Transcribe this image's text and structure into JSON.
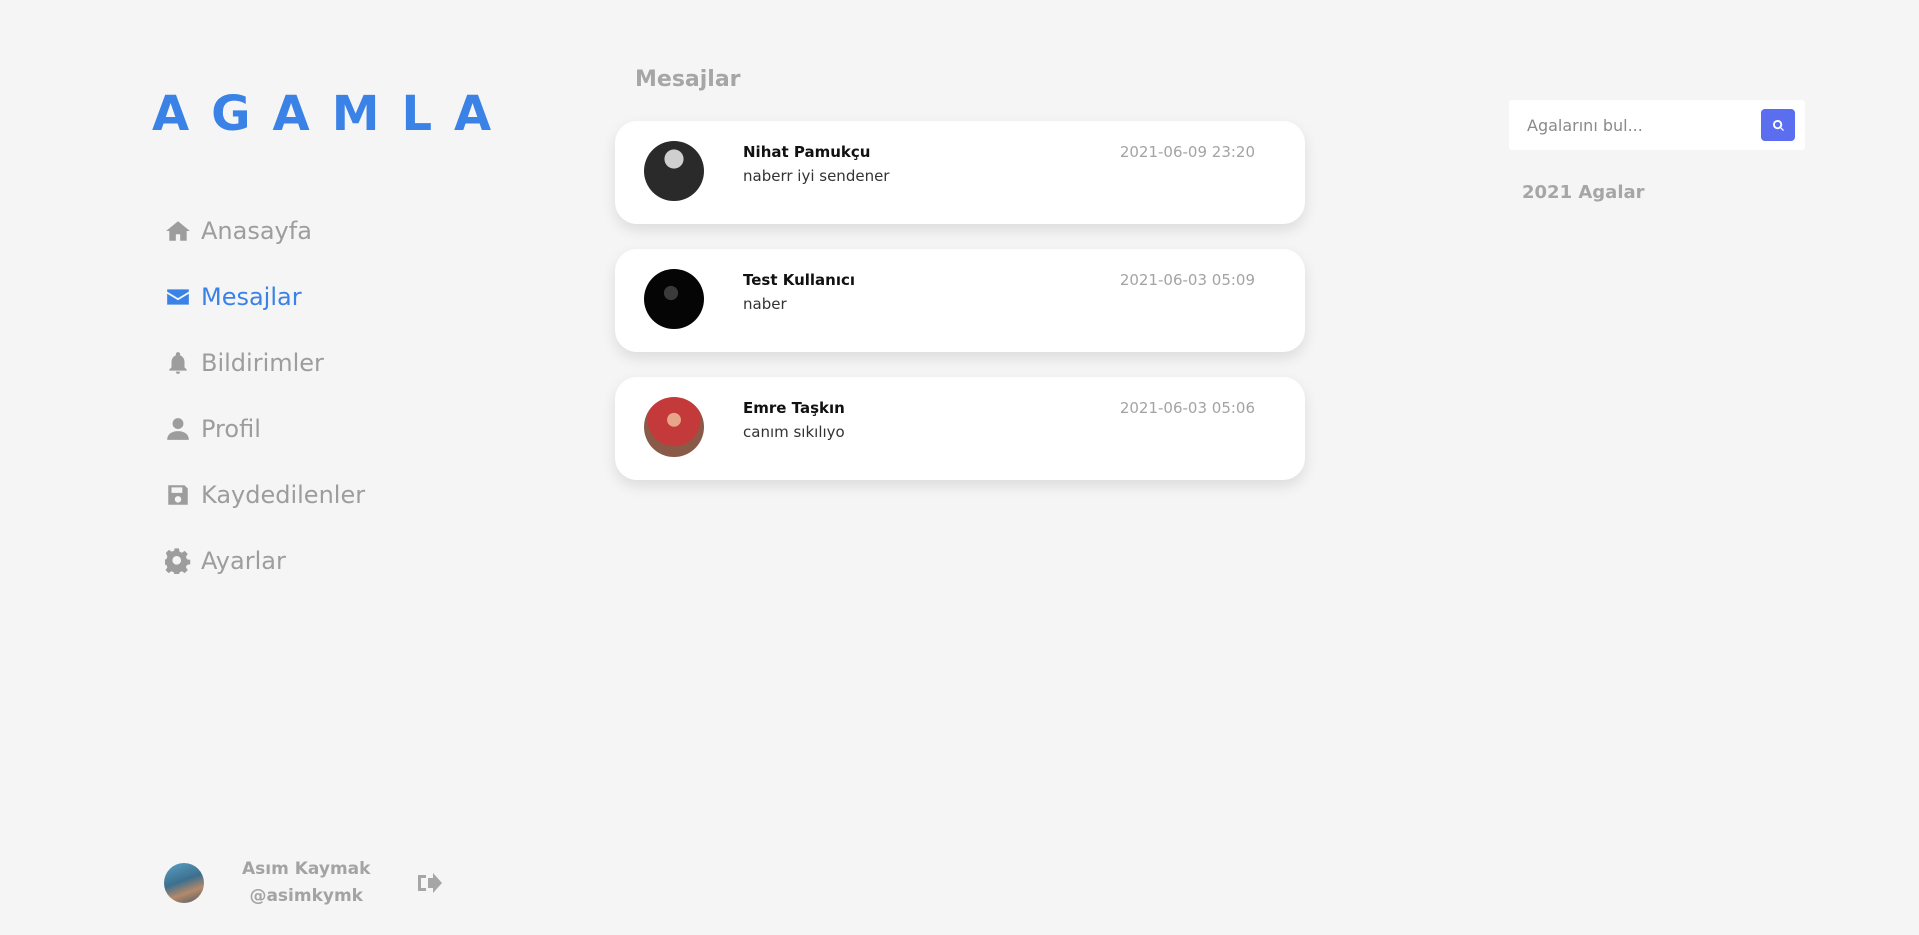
{
  "app": {
    "logo": "AGAMLA"
  },
  "sidebar": {
    "items": [
      {
        "label": "Anasayfa",
        "icon": "home-icon",
        "active": false
      },
      {
        "label": "Mesajlar",
        "icon": "envelope-icon",
        "active": true
      },
      {
        "label": "Bildirimler",
        "icon": "bell-icon",
        "active": false
      },
      {
        "label": "Profil",
        "icon": "user-icon",
        "active": false
      },
      {
        "label": "Kaydedilenler",
        "icon": "save-icon",
        "active": false
      },
      {
        "label": "Ayarlar",
        "icon": "gear-icon",
        "active": false
      }
    ],
    "user": {
      "name": "Asım Kaymak",
      "handle": "@asimkymk",
      "logout_icon": "logout-icon"
    }
  },
  "main": {
    "title": "Mesajlar",
    "messages": [
      {
        "name": "Nihat Pamukçu",
        "text": "naberr iyi sendener",
        "date": "2021-06-09 23:20"
      },
      {
        "name": "Test Kullanıcı",
        "text": "naber",
        "date": "2021-06-03 05:09"
      },
      {
        "name": "Emre Taşkın",
        "text": "canım sıkılıyo",
        "date": "2021-06-03 05:06"
      }
    ]
  },
  "right": {
    "search": {
      "placeholder": "Agalarını bul...",
      "value": ""
    },
    "section_title": "2021 Agalar"
  },
  "colors": {
    "accent": "#3b82e6",
    "search_button": "#5b6ef0",
    "muted": "#9d9d9d",
    "background": "#f4f5f4"
  }
}
